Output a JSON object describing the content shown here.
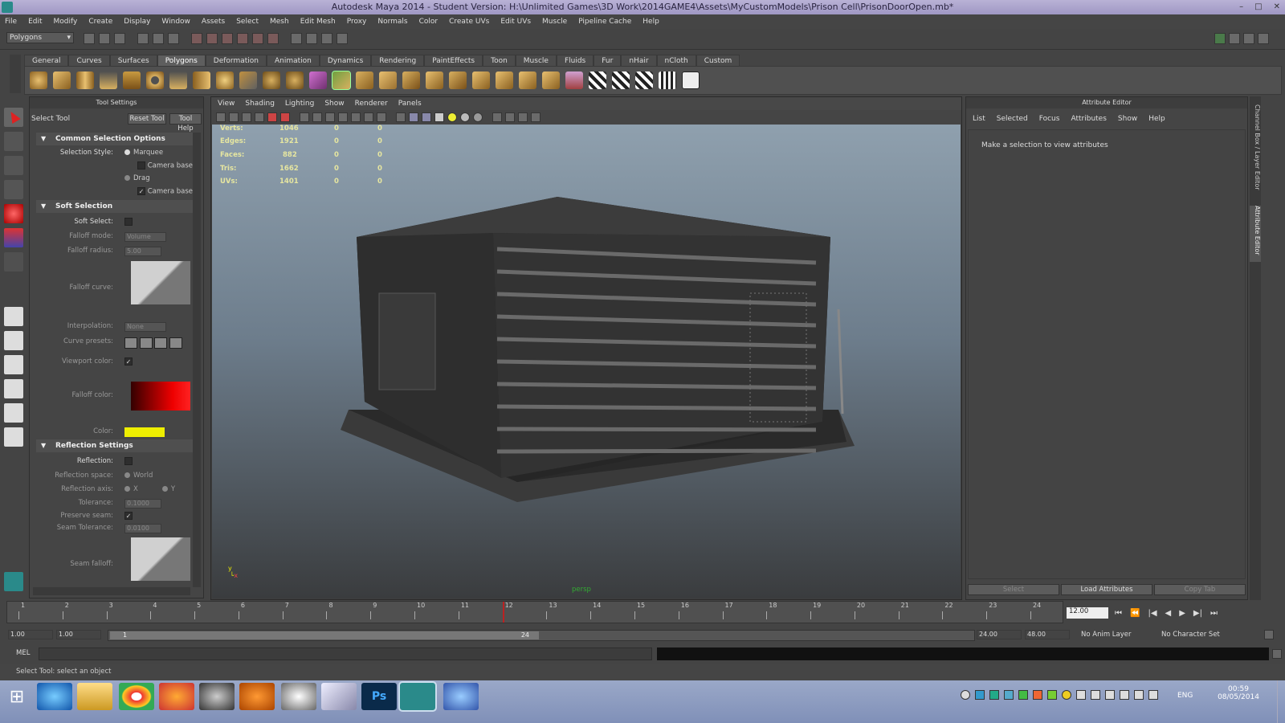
{
  "window": {
    "title": "Autodesk Maya 2014 - Student Version: H:\\Unlimited Games\\3D Work\\2014GAME4\\Assets\\MyCustomModels\\Prison Cell\\PrisonDoorOpen.mb*",
    "min": "–",
    "max": "□",
    "close": "✕"
  },
  "menu": [
    "File",
    "Edit",
    "Modify",
    "Create",
    "Display",
    "Window",
    "Assets",
    "Select",
    "Mesh",
    "Edit Mesh",
    "Proxy",
    "Normals",
    "Color",
    "Create UVs",
    "Edit UVs",
    "Muscle",
    "Pipeline Cache",
    "Help"
  ],
  "mode_selector": "Polygons",
  "shelf_tabs": [
    "General",
    "Curves",
    "Surfaces",
    "Polygons",
    "Deformation",
    "Animation",
    "Dynamics",
    "Rendering",
    "PaintEffects",
    "Toon",
    "Muscle",
    "Fluids",
    "Fur",
    "nHair",
    "nCloth",
    "Custom"
  ],
  "shelf_active": "Polygons",
  "tool_settings": {
    "header": "Tool Settings",
    "tool_name": "Select Tool",
    "reset_btn": "Reset Tool",
    "help_btn": "Tool Help",
    "sections": {
      "common": "Common Selection Options",
      "soft": "Soft Selection",
      "reflection": "Reflection Settings"
    },
    "selection_style_label": "Selection Style:",
    "marquee": "Marquee",
    "camera_based_1": "Camera based",
    "drag": "Drag",
    "camera_based_2": "Camera based",
    "soft_select_label": "Soft Select:",
    "falloff_mode_label": "Falloff mode:",
    "falloff_mode_value": "Volume",
    "falloff_radius_label": "Falloff radius:",
    "falloff_radius_value": "5.00",
    "falloff_curve_label": "Falloff curve:",
    "interpolation_label": "Interpolation:",
    "interpolation_value": "None",
    "curve_presets_label": "Curve presets:",
    "viewport_color_label": "Viewport color:",
    "falloff_color_label": "Falloff color:",
    "color_label": "Color:",
    "reflection_label": "Reflection:",
    "reflection_space_label": "Reflection space:",
    "reflection_space_value": "World",
    "reflection_axis_label": "Reflection axis:",
    "axis_x": "X",
    "axis_y": "Y",
    "tolerance_label": "Tolerance:",
    "tolerance_value": "0.1000",
    "preserve_seam_label": "Preserve seam:",
    "seam_tolerance_label": "Seam Tolerance:",
    "seam_tolerance_value": "0.0100",
    "seam_falloff_label": "Seam falloff:"
  },
  "viewport": {
    "menu": [
      "View",
      "Shading",
      "Lighting",
      "Show",
      "Renderer",
      "Panels"
    ],
    "camera_label": "persp",
    "hud": [
      {
        "label": "Verts:",
        "a": "1046",
        "b": "0",
        "c": "0"
      },
      {
        "label": "Edges:",
        "a": "1921",
        "b": "0",
        "c": "0"
      },
      {
        "label": "Faces:",
        "a": "882",
        "b": "0",
        "c": "0"
      },
      {
        "label": "Tris:",
        "a": "1662",
        "b": "0",
        "c": "0"
      },
      {
        "label": "UVs:",
        "a": "1401",
        "b": "0",
        "c": "0"
      }
    ]
  },
  "attribute_editor": {
    "header": "Attribute Editor",
    "menu": [
      "List",
      "Selected",
      "Focus",
      "Attributes",
      "Show",
      "Help"
    ],
    "message": "Make a selection to view attributes",
    "buttons": [
      "Select",
      "Load Attributes",
      "Copy Tab"
    ]
  },
  "right_tabs": [
    "Channel Box / Layer Editor",
    "Attribute Editor"
  ],
  "timeline": {
    "ticks": [
      "1",
      "2",
      "3",
      "4",
      "5",
      "6",
      "7",
      "8",
      "9",
      "10",
      "11",
      "12",
      "13",
      "14",
      "15",
      "16",
      "17",
      "18",
      "19",
      "20",
      "21",
      "22",
      "23",
      "24"
    ],
    "current": "12.00"
  },
  "range": {
    "start": "1.00",
    "start2": "1.00",
    "slider_start": "1",
    "slider_end": "24",
    "end": "24.00",
    "end2": "48.00",
    "anim_layer": "No Anim Layer",
    "char_set": "No Character Set"
  },
  "mel_label": "MEL",
  "help_line": "Select Tool: select an object",
  "taskbar": {
    "time": "00:59",
    "date": "08/05/2014",
    "lang": "ENG"
  }
}
